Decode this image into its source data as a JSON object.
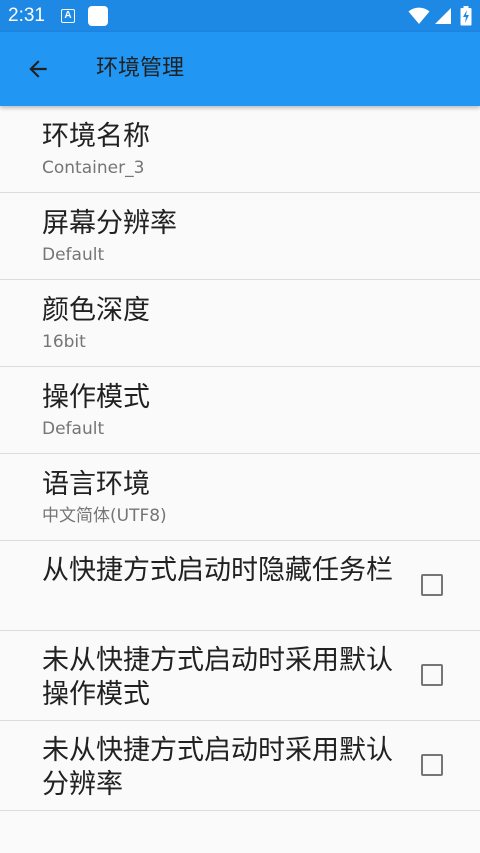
{
  "status_bar": {
    "time": "2:31",
    "notification_icon": "A"
  },
  "app_bar": {
    "title": "环境管理",
    "back_icon": "arrow-left-icon"
  },
  "settings": [
    {
      "title": "环境名称",
      "summary": "Container_3"
    },
    {
      "title": "屏幕分辨率",
      "summary": "Default"
    },
    {
      "title": "颜色深度",
      "summary": "16bit"
    },
    {
      "title": "操作模式",
      "summary": "Default"
    },
    {
      "title": "语言环境",
      "summary": "中文简体(UTF8)"
    }
  ],
  "checkbox_settings": [
    {
      "title": "从快捷方式启动时隐藏任务栏",
      "checked": false
    },
    {
      "title": "未从快捷方式启动时采用默认操作模式",
      "checked": false
    },
    {
      "title": "未从快捷方式启动时采用默认分辨率",
      "checked": false
    }
  ],
  "colors": {
    "status_bar": "#1e88e5",
    "app_bar": "#2196f3",
    "background": "#fafafa"
  }
}
